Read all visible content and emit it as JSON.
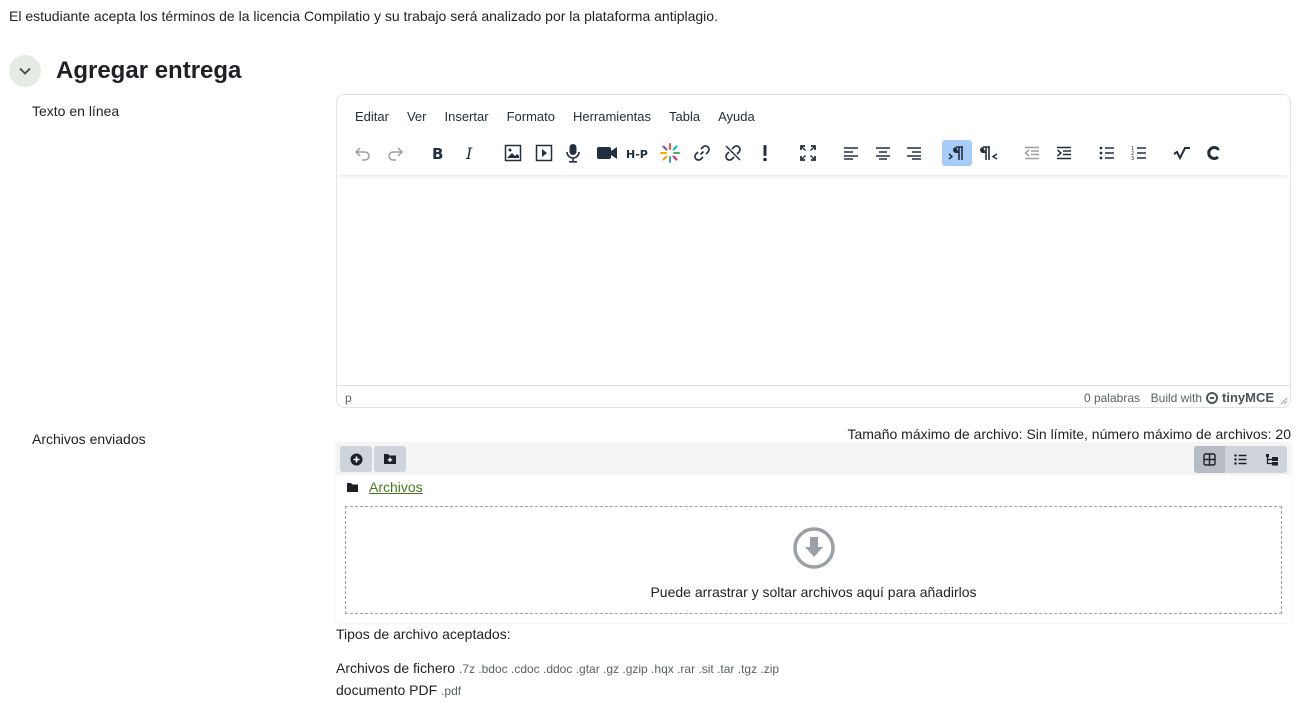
{
  "notice": "El estudiante acepta los términos de la licencia Compilatio y su trabajo será analizado por la plataforma antiplagio.",
  "section": {
    "title": "Agregar entrega"
  },
  "online_text": {
    "label": "Texto en línea",
    "menu": [
      "Editar",
      "Ver",
      "Insertar",
      "Formato",
      "Herramientas",
      "Tabla",
      "Ayuda"
    ],
    "status_path": "p",
    "word_count": "0 palabras",
    "build_with": "Build with",
    "brand": "tinyMCE"
  },
  "files": {
    "label": "Archivos enviados",
    "max_info": "Tamaño máximo de archivo: Sin límite, número máximo de archivos: 20",
    "breadcrumb": "Archivos",
    "drop_text": "Puede arrastrar y soltar archivos aquí para añadirlos"
  },
  "accepted": {
    "heading": "Tipos de archivo aceptados:",
    "types": [
      {
        "name": "Archivos de fichero",
        "exts": ".7z .bdoc .cdoc .ddoc .gtar .gz .gzip .hqx .rar .sit .tar .tgz .zip"
      },
      {
        "name": "documento PDF",
        "exts": ".pdf"
      }
    ]
  },
  "colors": {
    "accent_link": "#4a7b1f",
    "active_button": "#a6ccf7"
  }
}
